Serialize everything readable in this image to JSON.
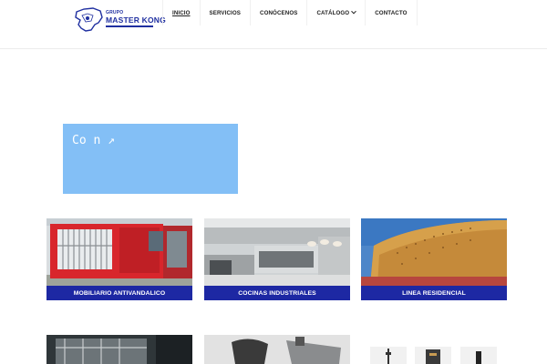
{
  "logo": {
    "small_text": "GRUPO",
    "main_text": "MASTER KONG",
    "brand_color": "#1f2fa0"
  },
  "nav": {
    "items": [
      {
        "label": "INICIO",
        "active": true
      },
      {
        "label": "SERVICIOS"
      },
      {
        "label": "CONÓCENOS"
      },
      {
        "label": "CATÁLOGO",
        "has_dropdown": true
      },
      {
        "label": "CONTACTO"
      }
    ]
  },
  "hero": {
    "text": "Co n ↗",
    "background": "#83bff6"
  },
  "categories": [
    {
      "label": "MOBILIARIO ANTIVANDALICO"
    },
    {
      "label": "COCINAS INDUSTRIALES"
    },
    {
      "label": "LINEA RESIDENCIAL"
    }
  ],
  "colors": {
    "caption_bar": "#1d28a3"
  }
}
